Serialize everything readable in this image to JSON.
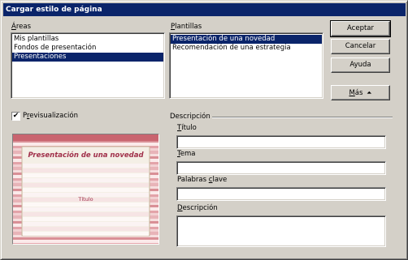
{
  "window": {
    "title": "Cargar estilo de página"
  },
  "areas": {
    "label_accel": "Á",
    "label_rest": "reas",
    "items": [
      {
        "label": "Mis plantillas",
        "selected": false
      },
      {
        "label": "Fondos de presentación",
        "selected": false
      },
      {
        "label": "Presentaciones",
        "selected": true
      }
    ]
  },
  "templates": {
    "label_accel": "P",
    "label_rest": "lantillas",
    "items": [
      {
        "label": "Presentación de una novedad",
        "selected": true
      },
      {
        "label": "Recomendación de una estrategia",
        "selected": false
      }
    ]
  },
  "buttons": {
    "accept": "Aceptar",
    "cancel": "Cancelar",
    "help": "Ayuda",
    "more_accel": "M",
    "more_rest": "ás",
    "more_arrow": "⏶"
  },
  "preview": {
    "checkbox_checked": true,
    "checkbox_mark": "✔",
    "label_pre": "P",
    "label_accel": "r",
    "label_rest": "evisualización",
    "slide_title": "Presentación de una novedad",
    "slide_subtitle": "Título",
    "accent_color": "#a0304a"
  },
  "description": {
    "group_label": "Descripción",
    "title_accel": "T",
    "title_rest": "ítulo",
    "title_value": "",
    "topic_accel": "T",
    "topic_rest": "ema",
    "topic_value": "",
    "keywords_pre": "Palabras ",
    "keywords_accel": "c",
    "keywords_rest": "lave",
    "keywords_value": "",
    "desc_accel": "D",
    "desc_rest": "escripción",
    "desc_value": ""
  }
}
